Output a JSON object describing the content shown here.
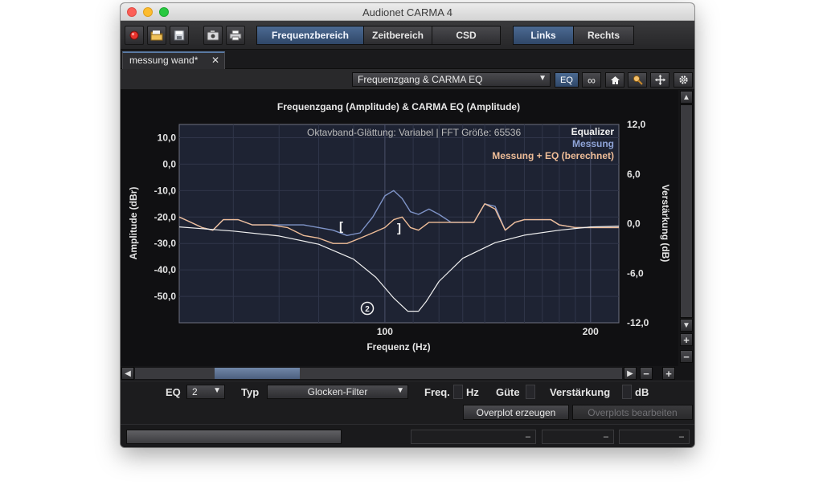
{
  "window": {
    "title": "Audionet CARMA 4"
  },
  "toolbar": {
    "icons": [
      "record-icon",
      "folder-icon",
      "save-icon",
      "camera-icon",
      "print-icon"
    ],
    "view_tabs": [
      "Frequenzbereich",
      "Zeitbereich",
      "CSD"
    ],
    "view_active": "Frequenzbereich",
    "channel_tabs": [
      "Links",
      "Rechts"
    ],
    "channel_active": "Links"
  },
  "document_tab": {
    "label": "messung wand*",
    "close": "✕"
  },
  "plot_controls": {
    "view_select": "Frequenzgang & CARMA EQ",
    "eq_button": "EQ",
    "link_icon": "∞",
    "icons": [
      "home-icon",
      "zoom-icon",
      "pan-icon",
      "gear-icon"
    ]
  },
  "chart_data": {
    "type": "line",
    "title": "Frequenzgang (Amplitude) & CARMA EQ (Amplitude)",
    "annotation": "Oktavband-Glättung: Variabel | FFT Größe: 65536",
    "xlabel": "Frequenz (Hz)",
    "ylabel": "Amplitude (dBr)",
    "y2label": "Verstärkung (dB)",
    "x_scale": "log",
    "xlim": [
      50,
      220
    ],
    "ylim": [
      -60,
      15
    ],
    "y2lim": [
      -12,
      12
    ],
    "x_ticks": [
      "100",
      "200"
    ],
    "y_ticks": [
      "10,0",
      "0,0",
      "-10,0",
      "-20,0",
      "-30,0",
      "-40,0",
      "-50,0"
    ],
    "y2_ticks": [
      "12,0",
      "6,0",
      "0,0",
      "-6,0",
      "-12,0"
    ],
    "grid": true,
    "legend_position": "top-right",
    "colors": {
      "Equalizer": "#f0f0f0",
      "Messung": "#7f94c8",
      "Messung + EQ (berechnet)": "#efbd98"
    },
    "series": [
      {
        "name": "Equalizer",
        "axis": "right",
        "x": [
          50,
          60,
          70,
          80,
          90,
          97,
          103,
          108,
          112,
          115,
          120,
          130,
          145,
          160,
          180,
          200,
          220
        ],
        "values": [
          -0.4,
          -0.9,
          -1.5,
          -2.5,
          -4.3,
          -6.5,
          -9.0,
          -10.6,
          -10.6,
          -9.4,
          -7.0,
          -4.2,
          -2.3,
          -1.4,
          -0.8,
          -0.4,
          -0.3
        ]
      },
      {
        "name": "Messung",
        "axis": "left",
        "x": [
          50,
          52,
          54,
          56,
          58,
          61,
          64,
          68,
          72,
          76,
          80,
          84,
          88,
          92,
          96,
          100,
          103,
          106,
          109,
          112,
          116,
          120,
          125,
          130,
          135,
          140,
          145,
          150,
          155,
          160,
          165,
          170,
          175,
          180,
          190,
          200,
          210,
          220
        ],
        "values": [
          -20,
          -22,
          -24,
          -25,
          -21,
          -21,
          -23,
          -23,
          -23,
          -23,
          -24,
          -25,
          -27,
          -26,
          -20,
          -12,
          -10,
          -13,
          -18,
          -19,
          -17,
          -19,
          -22,
          -22,
          -22,
          -15,
          -16,
          -25,
          -22,
          -21,
          -21,
          -21,
          -21,
          -23,
          -24,
          -24,
          -24,
          -24
        ]
      },
      {
        "name": "Messung + EQ (berechnet)",
        "axis": "left",
        "x": [
          50,
          52,
          54,
          56,
          58,
          61,
          64,
          68,
          72,
          76,
          80,
          84,
          88,
          92,
          96,
          100,
          103,
          106,
          109,
          112,
          116,
          120,
          125,
          130,
          135,
          140,
          145,
          150,
          155,
          160,
          165,
          170,
          175,
          180,
          190,
          200,
          210,
          220
        ],
        "values": [
          -20,
          -22,
          -24,
          -25,
          -21,
          -21,
          -23,
          -23,
          -24,
          -27,
          -28,
          -30,
          -30,
          -28,
          -26,
          -24,
          -21,
          -20,
          -24,
          -25,
          -22,
          -22,
          -22,
          -22,
          -22,
          -15,
          -17,
          -25,
          -22,
          -21,
          -21,
          -21,
          -21,
          -23,
          -24,
          -24,
          -24,
          -24
        ]
      }
    ],
    "eq_handles": {
      "left": "[",
      "right": "]",
      "marker": "2"
    }
  },
  "eq_panel": {
    "eq_label": "EQ",
    "eq_value": "2",
    "typ_label": "Typ",
    "typ_value": "Glocken-Filter",
    "freq_label": "Freq.",
    "freq_unit": "Hz",
    "guete_label": "Güte",
    "gain_label": "Verstärkung",
    "gain_unit": "dB"
  },
  "actions": {
    "overplot_create": "Overplot erzeugen",
    "overplot_edit": "Overplots bearbeiten"
  },
  "status": {
    "fields": [
      "–",
      "–",
      "–"
    ]
  }
}
